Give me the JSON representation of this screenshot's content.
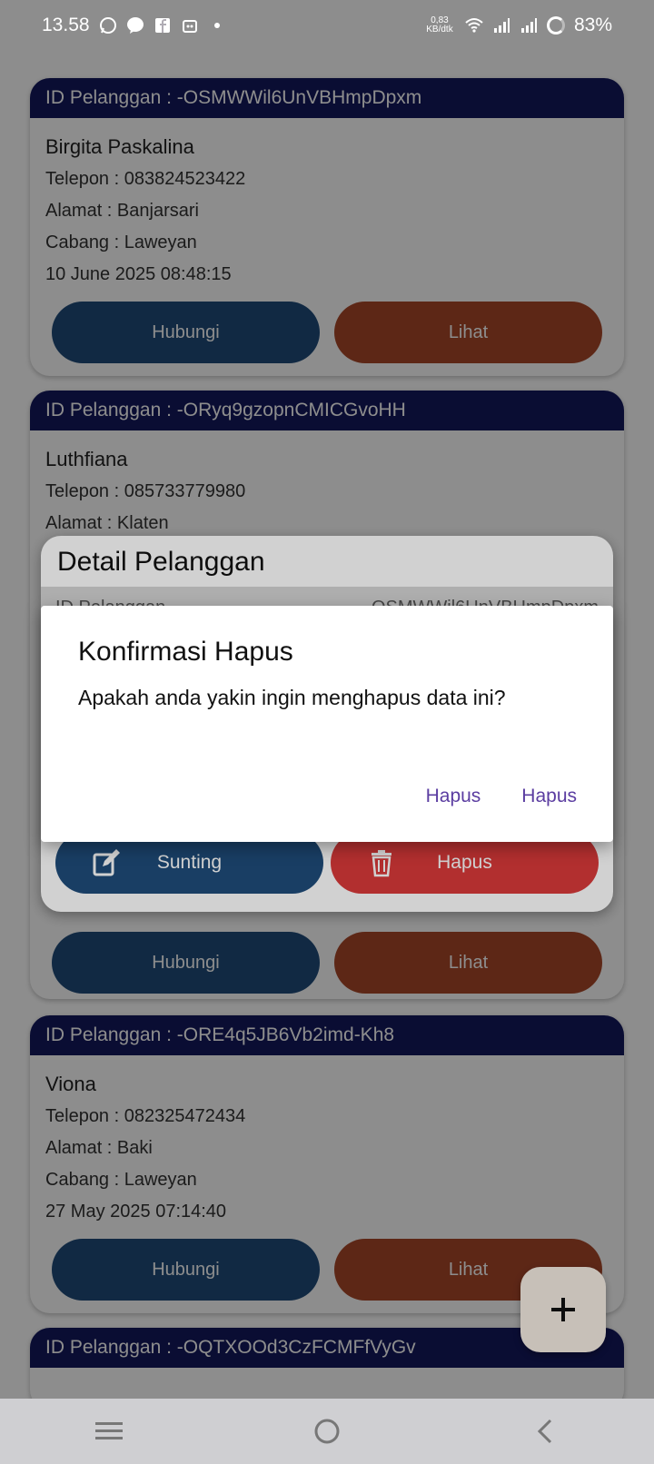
{
  "status_bar": {
    "time": "13.58",
    "net_speed": "0,83\nKB/dtk",
    "battery": "83%"
  },
  "customers": [
    {
      "id_label": "ID Pelanggan : -OSMWWil6UnVBHmpDpxm",
      "name": "Birgita Paskalina",
      "phone": "Telepon : 083824523422",
      "address": "Alamat : Banjarsari",
      "branch": "Cabang : Laweyan",
      "date": "10 June 2025 08:48:15",
      "contact_label": "Hubungi",
      "view_label": "Lihat"
    },
    {
      "id_label": "ID Pelanggan : -ORyq9gzopnCMICGvoHH",
      "name": "Luthfiana",
      "phone": "Telepon : 085733779980",
      "address": "Alamat : Klaten",
      "contact_label": "Hubungi",
      "view_label": "Lihat"
    },
    {
      "id_label": "ID Pelanggan : -ORE4q5JB6Vb2imd-Kh8",
      "name": "Viona",
      "phone": "Telepon : 082325472434",
      "address": "Alamat : Baki",
      "branch": "Cabang : Laweyan",
      "date": "27 May 2025 07:14:40",
      "contact_label": "Hubungi",
      "view_label": "Lihat"
    },
    {
      "id_label": "ID Pelanggan : -OQTXOOd3CzFCMFfVyGv"
    }
  ],
  "detail_sheet": {
    "title": "Detail Pelanggan",
    "row_label": "ID Pelanggan",
    "row_value": "-OSMWWil6UnVBHmpDpxm",
    "edit_label": "Sunting",
    "delete_label": "Hapus"
  },
  "dialog": {
    "title": "Konfirmasi Hapus",
    "message": "Apakah anda yakin ingin menghapus data ini?",
    "button_1": "Hapus",
    "button_2": "Hapus"
  },
  "fab": {
    "icon": "plus-icon"
  },
  "colors": {
    "header": "#14195e",
    "primary_button": "#1f4c7a",
    "secondary_button": "#a9482a",
    "delete_button": "#d93a3a",
    "dialog_action": "#5b3da1"
  }
}
